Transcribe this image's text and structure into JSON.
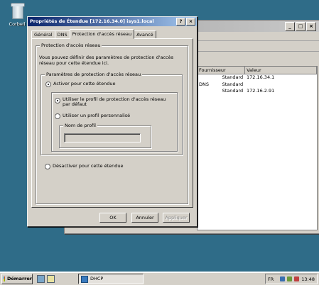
{
  "desktop": {
    "recycle_bin_label": "Corbeil"
  },
  "background_window": {
    "list": {
      "columns": [
        "Fournisseur",
        "Valeur"
      ],
      "rows": [
        {
          "provider": "Standard",
          "value": "172.16.34.1"
        },
        {
          "provider": "Standard",
          "value": ""
        },
        {
          "provider": "Standard",
          "value": "172.16.2.91"
        }
      ],
      "side_label": "DNS"
    },
    "controls": {
      "minimize": "_",
      "maximize": "□",
      "close": "×"
    }
  },
  "dialog": {
    "title": "Propriétés de Étendue [172.16.34.0] isys1.local",
    "title_controls": {
      "help": "?",
      "close": "×"
    },
    "tabs": [
      "Général",
      "DNS",
      "Protection d'accès réseau",
      "Avancé"
    ],
    "active_tab": 2,
    "outer_group_title": "Protection d'accès réseau",
    "description": "Vous pouvez définir des paramètres de protection d'accès réseau pour cette étendue ici.",
    "inner_group_title": "Paramètres de protection d'accès réseau",
    "radio_enable": "Activer pour cette étendue",
    "radio_default_profile": "Utiliser le profil de protection d'accès réseau par défaut",
    "radio_custom_profile": "Utiliser un profil personnalisé",
    "profile_group_title": "Nom de profil",
    "profile_name_value": "",
    "radio_disable": "Désactiver pour cette étendue",
    "buttons": {
      "ok": "OK",
      "cancel": "Annuler",
      "apply": "Appliquer"
    }
  },
  "taskbar": {
    "start_label": "Démarrer",
    "task_label": "DHCP",
    "language": "FR",
    "clock": "13:48"
  },
  "icons": {
    "recycle_bin": "recycle-bin-icon",
    "start": "windows-logo-icon",
    "dhcp": "dhcp-icon"
  }
}
